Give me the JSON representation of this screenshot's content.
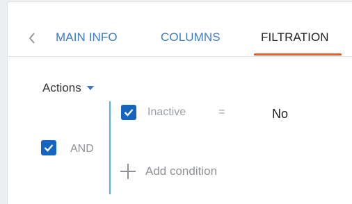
{
  "tabs": {
    "items": [
      {
        "label": "MAIN INFO",
        "active": false
      },
      {
        "label": "COLUMNS",
        "active": false
      },
      {
        "label": "FILTRATION",
        "active": true
      }
    ],
    "back_icon": "chevron-left-icon"
  },
  "filter": {
    "actions_label": "Actions",
    "group": {
      "logic_label": "AND",
      "checked": true,
      "conditions": [
        {
          "column": "Inactive",
          "operator": "=",
          "value": "No",
          "checked": true
        }
      ]
    },
    "add_condition_label": "Add condition"
  },
  "colors": {
    "accent": "#3d7bc6",
    "active_underline": "#e35b2c",
    "checkbox": "#1565c0",
    "group_line": "#4fb7d9"
  }
}
